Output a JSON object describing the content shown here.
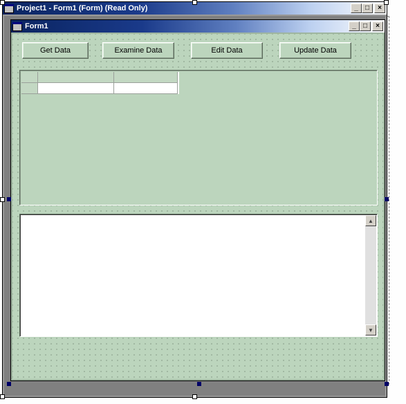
{
  "outerWindow": {
    "title": "Project1 - Form1 (Form)  (Read Only)"
  },
  "innerWindow": {
    "title": "Form1"
  },
  "buttons": {
    "getData": "Get Data",
    "examineData": "Examine Data",
    "editData": "Edit Data",
    "updateData": "Update Data"
  },
  "grid": {
    "rows": 2,
    "cols": 3
  },
  "textbox": {
    "value": ""
  }
}
